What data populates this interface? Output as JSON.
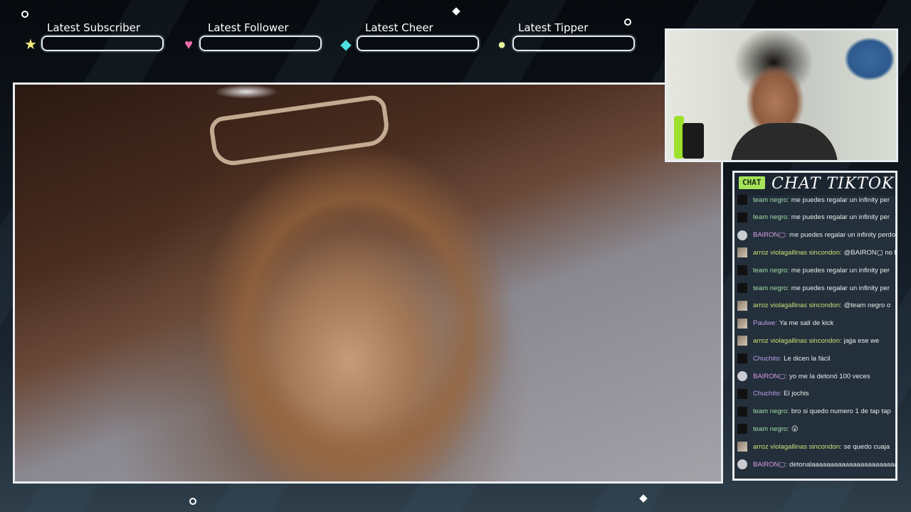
{
  "alerts": [
    {
      "label": "Latest Subscriber",
      "icon": "★",
      "icon_name": "star-icon",
      "icon_color": "#f4e97a",
      "value": ""
    },
    {
      "label": "Latest Follower",
      "icon": "♥",
      "icon_name": "heart-icon",
      "icon_color": "#ee6aa8",
      "value": ""
    },
    {
      "label": "Latest Cheer",
      "icon": "◆",
      "icon_name": "diamond-icon",
      "icon_color": "#4fe0e0",
      "value": ""
    },
    {
      "label": "Latest Tipper",
      "icon": "●",
      "icon_name": "coin-icon",
      "icon_color": "#e8f29a",
      "value": ""
    }
  ],
  "chat": {
    "badge": "CHAT",
    "title": "CHAT TIKTOK",
    "messages": [
      {
        "user": "team negro:",
        "text": "me puedes regalar un infinity per",
        "avatar": "dark",
        "color": "green"
      },
      {
        "user": "team negro:",
        "text": "me puedes regalar un infinity per",
        "avatar": "dark",
        "color": "green"
      },
      {
        "user": "BAIRON▢:",
        "text": "me puedes regalar un infinity perdo",
        "avatar": "round",
        "color": "pink"
      },
      {
        "user": "arroz violagallinas sincondon:",
        "text": "@BAIRON▢ no l",
        "avatar": "img",
        "color": "lime"
      },
      {
        "user": "team negro:",
        "text": "me puedes regalar un infinity per",
        "avatar": "dark",
        "color": "green"
      },
      {
        "user": "team negro:",
        "text": "me puedes regalar un infinity per",
        "avatar": "dark",
        "color": "green"
      },
      {
        "user": "arroz violagallinas sincondon:",
        "text": "@team negro o",
        "avatar": "img",
        "color": "lime"
      },
      {
        "user": "Paulwe:",
        "text": "Ya me salí de kick",
        "avatar": "img",
        "color": "purple"
      },
      {
        "user": "arroz violagallinas sincondon:",
        "text": "jajja ese we",
        "avatar": "img",
        "color": "lime"
      },
      {
        "user": "Chuchito:",
        "text": "Le dicen la fácil",
        "avatar": "dark",
        "color": "purple"
      },
      {
        "user": "BAIRON▢:",
        "text": "yo me la detonó 100 veces",
        "avatar": "round",
        "color": "pink"
      },
      {
        "user": "Chuchito:",
        "text": "El jochis",
        "avatar": "dark",
        "color": "purple"
      },
      {
        "user": "team negro:",
        "text": "bro si quedo numero 1 de tap tap",
        "avatar": "dark",
        "color": "green"
      },
      {
        "user": "team negro:",
        "text": "😮",
        "avatar": "dark",
        "color": "green"
      },
      {
        "user": "arroz violagallinas sincondon:",
        "text": "se quedo cuaja",
        "avatar": "img",
        "color": "lime"
      },
      {
        "user": "BAIRON▢:",
        "text": "detonalaaaaaaaaaaaaaaaaaaaaaaa",
        "avatar": "round",
        "color": "pink"
      }
    ]
  }
}
